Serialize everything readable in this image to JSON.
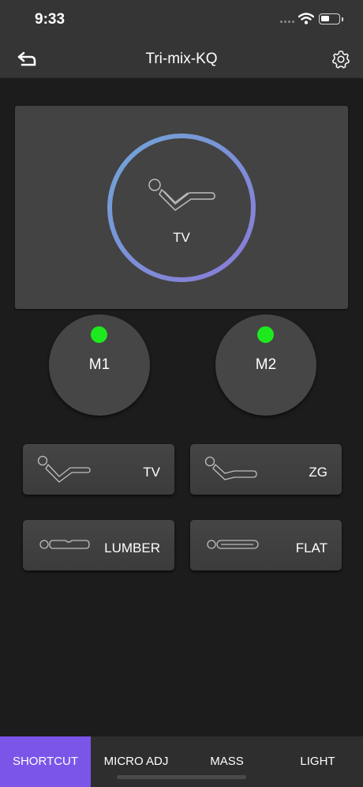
{
  "status_bar": {
    "time": "9:33",
    "icons": [
      "signal-icon",
      "wifi-icon",
      "battery-icon"
    ],
    "battery_level": 0.5
  },
  "nav": {
    "title": "Tri-mix-KQ",
    "back_icon": "back-arrow-icon",
    "settings_icon": "gear-icon"
  },
  "hero": {
    "label": "TV",
    "ring_colors": [
      "#6fa6d8",
      "#8a7ad8"
    ]
  },
  "memory": [
    {
      "label": "M1",
      "indicator_color": "#1ee81e"
    },
    {
      "label": "M2",
      "indicator_color": "#1ee81e"
    }
  ],
  "presets": [
    {
      "label": "TV",
      "icon": "tv-position-icon"
    },
    {
      "label": "ZG",
      "icon": "zero-gravity-icon"
    },
    {
      "label": "LUMBER",
      "icon": "lumbar-icon"
    },
    {
      "label": "FLAT",
      "icon": "flat-icon"
    }
  ],
  "tabs": [
    {
      "label": "SHORTCUT",
      "active": true
    },
    {
      "label": "MICRO ADJ",
      "active": false
    },
    {
      "label": "MASS",
      "active": false
    },
    {
      "label": "LIGHT",
      "active": false
    }
  ],
  "colors": {
    "accent": "#7a55e8",
    "background": "#1c1c1c",
    "card": "#434343",
    "indicator": "#1ee81e"
  }
}
